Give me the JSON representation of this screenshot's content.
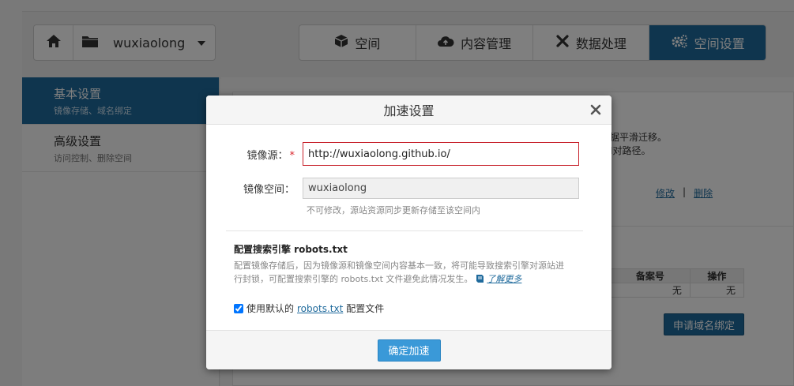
{
  "project": {
    "name": "wuxiaolong"
  },
  "nav_tabs": [
    {
      "label": "空间",
      "icon": "cube-icon"
    },
    {
      "label": "内容管理",
      "icon": "cloud-upload-icon"
    },
    {
      "label": "数据处理",
      "icon": "tools-icon"
    },
    {
      "label": "空间设置",
      "icon": "gears-icon",
      "active": true
    }
  ],
  "sidebar": {
    "items": [
      {
        "title": "基本设置",
        "subtitle": "镜像存储、域名绑定",
        "active": true
      },
      {
        "title": "高级设置",
        "subtitle": "访问控制、删除空间"
      }
    ]
  },
  "background": {
    "note_line1": "据平滑迁移。",
    "note_line2": "I对路径。",
    "link_edit": "修改",
    "link_sep": "|",
    "link_delete": "删除",
    "table_headers": [
      "备案号",
      "操作"
    ],
    "table_row": [
      "无",
      "无"
    ],
    "bind_button": "申请域名绑定"
  },
  "modal": {
    "title": "加速设置",
    "mirror_source_label": "镜像源：",
    "required_mark": "*",
    "mirror_source_value": "http://wuxiaolong.github.io/",
    "mirror_space_label": "镜像空间：",
    "mirror_space_value": "wuxiaolong",
    "mirror_space_hint": "不可修改，源站资源同步更新存储至该空间内",
    "robots_title": "配置搜索引擎 robots.txt",
    "robots_desc": "配置镜像存储后，因为镜像源和镜像空间内容基本一致，将可能导致搜索引擎对源站进行封锁，可配置搜索引擎的 robots.txt 文件避免此情况发生。",
    "learn_more": "了解更多",
    "checkbox_prefix": "使用默认的",
    "checkbox_link": "robots.txt",
    "checkbox_suffix": "配置文件",
    "checkbox_checked": true,
    "confirm_button": "确定加速"
  },
  "colors": {
    "accent": "#1f6a9c",
    "primary_button": "#3a99d8",
    "error_border": "#c7202a"
  }
}
